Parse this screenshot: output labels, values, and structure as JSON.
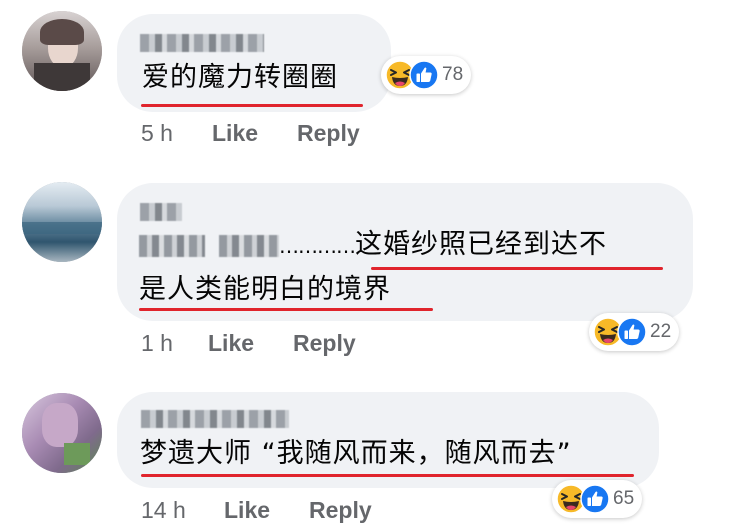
{
  "comments": [
    {
      "text_lines": [
        "爱的魔力转圈圈"
      ],
      "time": "5 h",
      "like_label": "Like",
      "reply_label": "Reply",
      "reaction_count": "78",
      "reaction_icons": [
        "haha-icon",
        "like-icon"
      ]
    },
    {
      "text_prefix": "…………",
      "text_lines": [
        "这婚纱照已经到达不",
        "是人类能明白的境界"
      ],
      "time": "1 h",
      "like_label": "Like",
      "reply_label": "Reply",
      "reaction_count": "22",
      "reaction_icons": [
        "haha-icon",
        "like-icon"
      ]
    },
    {
      "text_lines": [
        "梦遗大师 “我随风而来，随风而去”"
      ],
      "time": "14 h",
      "like_label": "Like",
      "reply_label": "Reply",
      "reaction_count": "65",
      "reaction_icons": [
        "haha-icon",
        "like-icon"
      ]
    }
  ],
  "colors": {
    "bubble": "#f0f2f5",
    "underline": "#e0242c",
    "meta_text": "#65676b",
    "like_blue": "#1877f2",
    "haha_yellow": "#f7b928"
  }
}
